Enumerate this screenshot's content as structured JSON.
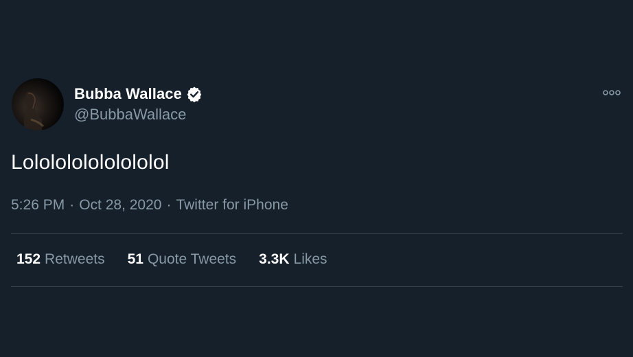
{
  "author": {
    "display_name": "Bubba Wallace",
    "handle": "@BubbaWallace",
    "verified_icon": "verified-badge-icon",
    "avatar_icon": "profile-photo"
  },
  "tweet": {
    "text": "Lololololololololol",
    "time": "5:26 PM",
    "separator": "·",
    "date": "Oct 28, 2020",
    "source": "Twitter for iPhone"
  },
  "stats": {
    "retweets_count": "152",
    "retweets_label": "Retweets",
    "quote_tweets_count": "51",
    "quote_tweets_label": "Quote Tweets",
    "likes_count": "3.3K",
    "likes_label": "Likes"
  },
  "menu": {
    "more_icon": "more-options-icon"
  },
  "colors": {
    "background": "#15202b",
    "primary_text": "#ffffff",
    "secondary_text": "#8899a6",
    "divider": "#38444d"
  }
}
